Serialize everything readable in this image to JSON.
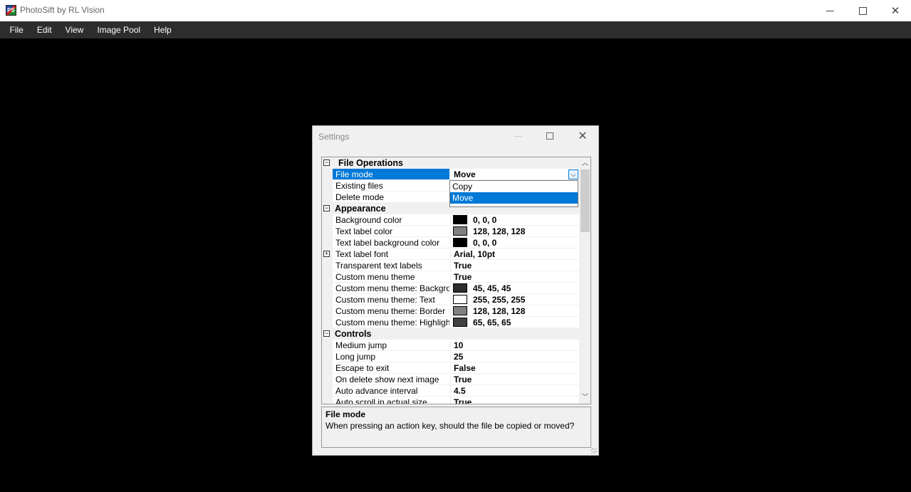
{
  "app": {
    "title": "PhotoSift by RL Vision",
    "icon": "photosift-app-icon",
    "icon_letters": "PS"
  },
  "window_controls": {
    "minimize": "minimize-icon",
    "maximize": "maximize-icon",
    "close": "close-icon"
  },
  "menu": [
    "File",
    "Edit",
    "View",
    "Image Pool",
    "Help"
  ],
  "dialog": {
    "title": "Settings",
    "categories": {
      "file_ops": "File Operations",
      "appearance": "Appearance",
      "controls": "Controls"
    },
    "rows": [
      {
        "name": "File mode",
        "value": "Move"
      },
      {
        "name": "Existing files",
        "value": ""
      },
      {
        "name": "Delete mode",
        "value": ""
      },
      {
        "name": "Background color",
        "value": "0, 0, 0",
        "color": "#000000"
      },
      {
        "name": "Text label color",
        "value": "128, 128, 128",
        "color": "#808080"
      },
      {
        "name": "Text label background color",
        "value": "0, 0, 0",
        "color": "#000000"
      },
      {
        "name": "Text label font",
        "value": "Arial, 10pt"
      },
      {
        "name": "Transparent text labels",
        "value": "True"
      },
      {
        "name": "Custom menu theme",
        "value": "True"
      },
      {
        "name": "Custom menu theme: Background",
        "value": "45, 45, 45",
        "color": "#2d2d2d"
      },
      {
        "name": "Custom menu theme: Text",
        "value": "255, 255, 255",
        "color": "#ffffff"
      },
      {
        "name": "Custom menu theme: Border",
        "value": "128, 128, 128",
        "color": "#808080"
      },
      {
        "name": "Custom menu theme: Highlight",
        "value": "65, 65, 65",
        "color": "#414141"
      },
      {
        "name": "Medium jump",
        "value": "10"
      },
      {
        "name": "Long jump",
        "value": "25"
      },
      {
        "name": "Escape to exit",
        "value": "False"
      },
      {
        "name": "On delete show next image",
        "value": "True"
      },
      {
        "name": "Auto advance interval",
        "value": "4.5"
      },
      {
        "name": "Auto scroll in actual size",
        "value": "True"
      }
    ],
    "dropdown": {
      "options": [
        "Copy",
        "Move"
      ],
      "highlighted": "Move"
    },
    "help": {
      "title": "File mode",
      "description": "When pressing an action key, should the file be copied or moved?"
    }
  },
  "colors": {
    "menu_bg": "#2d2d2d",
    "selection": "#0078d7",
    "background": "#000000"
  }
}
